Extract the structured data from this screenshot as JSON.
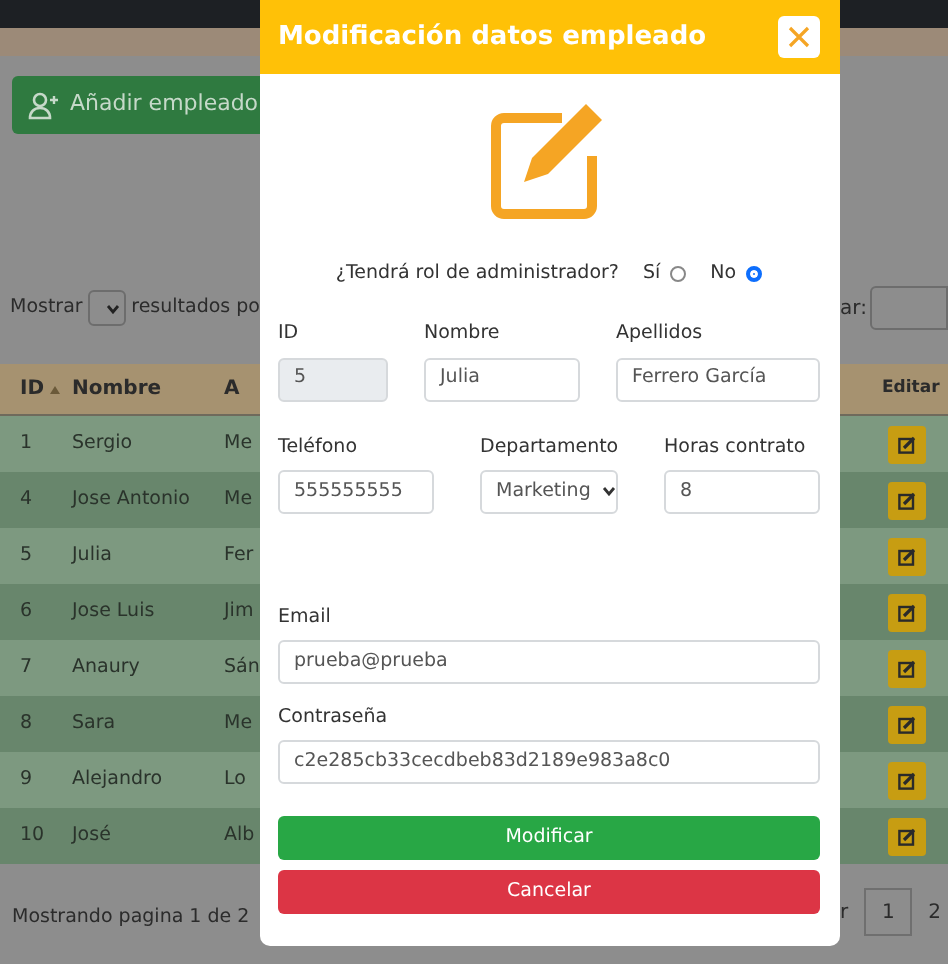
{
  "page": {
    "add_button": "Añadir empleado",
    "length": {
      "before": "Mostrar",
      "after": "resultados po"
    },
    "search_label": "ar:",
    "table": {
      "columns": [
        {
          "label": "ID"
        },
        {
          "label": "Nombre"
        },
        {
          "label": "A"
        },
        {
          "label": "Editar"
        }
      ],
      "rows": [
        {
          "id": "1",
          "nombre": "Sergio",
          "column_3": "Me"
        },
        {
          "id": "4",
          "nombre": "Jose Antonio",
          "column_3": "Me"
        },
        {
          "id": "5",
          "nombre": "Julia",
          "column_3": "Fer"
        },
        {
          "id": "6",
          "nombre": "Jose Luis",
          "column_3": "Jim"
        },
        {
          "id": "7",
          "nombre": "Anaury",
          "column_3": "Sán"
        },
        {
          "id": "8",
          "nombre": "Sara",
          "column_3": "Me"
        },
        {
          "id": "9",
          "nombre": "Alejandro",
          "column_3": "Lo"
        },
        {
          "id": "10",
          "nombre": "José",
          "column_3": "Alb"
        }
      ]
    },
    "footer": "Mostrando pagina 1 de 2",
    "pagination": [
      "r",
      "1",
      "2"
    ]
  },
  "modal": {
    "title": "Modificación datos empleado",
    "admin_role": {
      "question": "¿Tendrá rol de administrador?",
      "options": [
        {
          "label": "Sí",
          "selected": false
        },
        {
          "label": "No",
          "selected": true
        }
      ]
    },
    "field_rows": [
      {
        "fields": [
          {
            "label": "ID",
            "value": "5",
            "kind": "text",
            "disabled": true
          },
          {
            "label": "Nombre",
            "value": "Julia",
            "kind": "text",
            "disabled": false
          },
          {
            "label": "Apellidos",
            "value": "Ferrero García",
            "kind": "text",
            "disabled": false
          }
        ]
      },
      {
        "fields": [
          {
            "label": "Teléfono",
            "value": "555555555",
            "kind": "text",
            "disabled": false
          },
          {
            "label": "Departamento",
            "value": "Marketing",
            "kind": "select",
            "disabled": false
          },
          {
            "label": "Horas contrato",
            "value": "8",
            "kind": "text",
            "disabled": false
          }
        ]
      },
      {
        "fields": [
          {
            "label": "Email",
            "value": "prueba@prueba",
            "kind": "text",
            "disabled": false
          }
        ]
      },
      {
        "fields": [
          {
            "label": "Contraseña",
            "value": "c2e285cb33cecdbeb83d2189e983a8c0",
            "kind": "text",
            "disabled": false
          }
        ]
      }
    ],
    "buttons": [
      {
        "label": "Modificar",
        "kind": "success"
      },
      {
        "label": "Cancelar",
        "kind": "danger"
      }
    ]
  }
}
